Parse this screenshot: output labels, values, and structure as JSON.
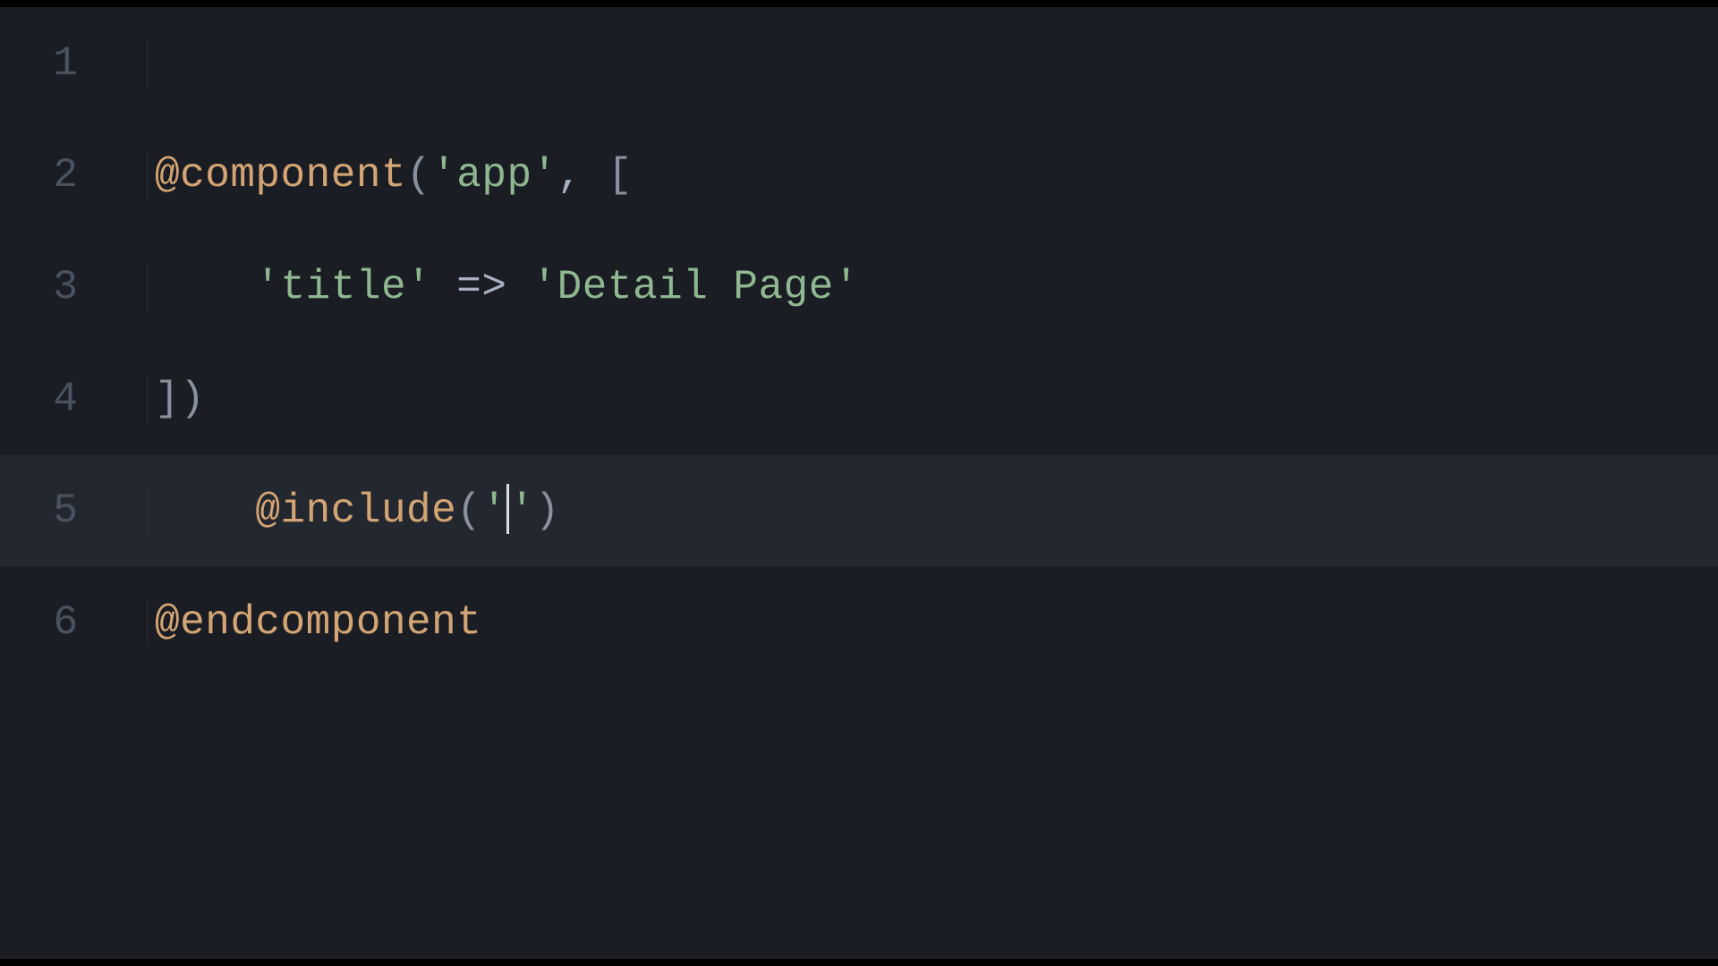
{
  "editor": {
    "active_line": 5,
    "lines": [
      {
        "num": "1",
        "tokens": []
      },
      {
        "num": "2",
        "tokens": [
          {
            "cls": "tok-directive",
            "t": "@component"
          },
          {
            "cls": "tok-punct",
            "t": "("
          },
          {
            "cls": "tok-string",
            "t": "'app'"
          },
          {
            "cls": "tok-default",
            "t": ", "
          },
          {
            "cls": "tok-punct",
            "t": "["
          }
        ]
      },
      {
        "num": "3",
        "indent": "    ",
        "tokens": [
          {
            "cls": "tok-string",
            "t": "'title'"
          },
          {
            "cls": "tok-default",
            "t": " => "
          },
          {
            "cls": "tok-string",
            "t": "'Detail Page'"
          }
        ]
      },
      {
        "num": "4",
        "tokens": [
          {
            "cls": "tok-punct",
            "t": "])"
          }
        ]
      },
      {
        "num": "5",
        "indent": "    ",
        "tokens": [
          {
            "cls": "tok-directive",
            "t": "@include"
          },
          {
            "cls": "tok-punct",
            "t": "("
          },
          {
            "cls": "tok-string",
            "t": "'"
          },
          {
            "cursor": true
          },
          {
            "cls": "tok-string",
            "t": "'"
          },
          {
            "cls": "tok-punct",
            "t": ")"
          }
        ]
      },
      {
        "num": "6",
        "tokens": [
          {
            "cls": "tok-directive",
            "t": "@endcomponent"
          }
        ]
      }
    ]
  }
}
